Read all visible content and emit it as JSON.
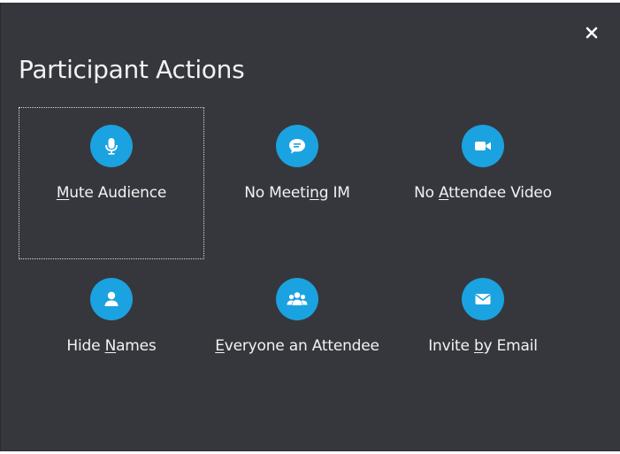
{
  "dialog": {
    "title": "Participant Actions",
    "close_icon": "close-icon",
    "accent_color": "#1ba2e0",
    "background_color": "#36373c"
  },
  "actions": [
    {
      "id": "mute-audience",
      "label": "Mute Audience",
      "mnemonic_index": 0,
      "icon": "microphone-icon"
    },
    {
      "id": "no-meeting-im",
      "label": "No Meeting IM",
      "mnemonic_index": 8,
      "icon": "chat-bubble-icon"
    },
    {
      "id": "no-attendee-video",
      "label": "No Attendee Video",
      "mnemonic_index": 3,
      "icon": "video-camera-icon"
    },
    {
      "id": "hide-names",
      "label": "Hide Names",
      "mnemonic_index": 5,
      "icon": "person-icon"
    },
    {
      "id": "everyone-an-attendee",
      "label": "Everyone an Attendee",
      "mnemonic_index": 0,
      "icon": "group-icon"
    },
    {
      "id": "invite-by-email",
      "label": "Invite by Email",
      "mnemonic_index": 7,
      "icon": "envelope-icon"
    }
  ]
}
